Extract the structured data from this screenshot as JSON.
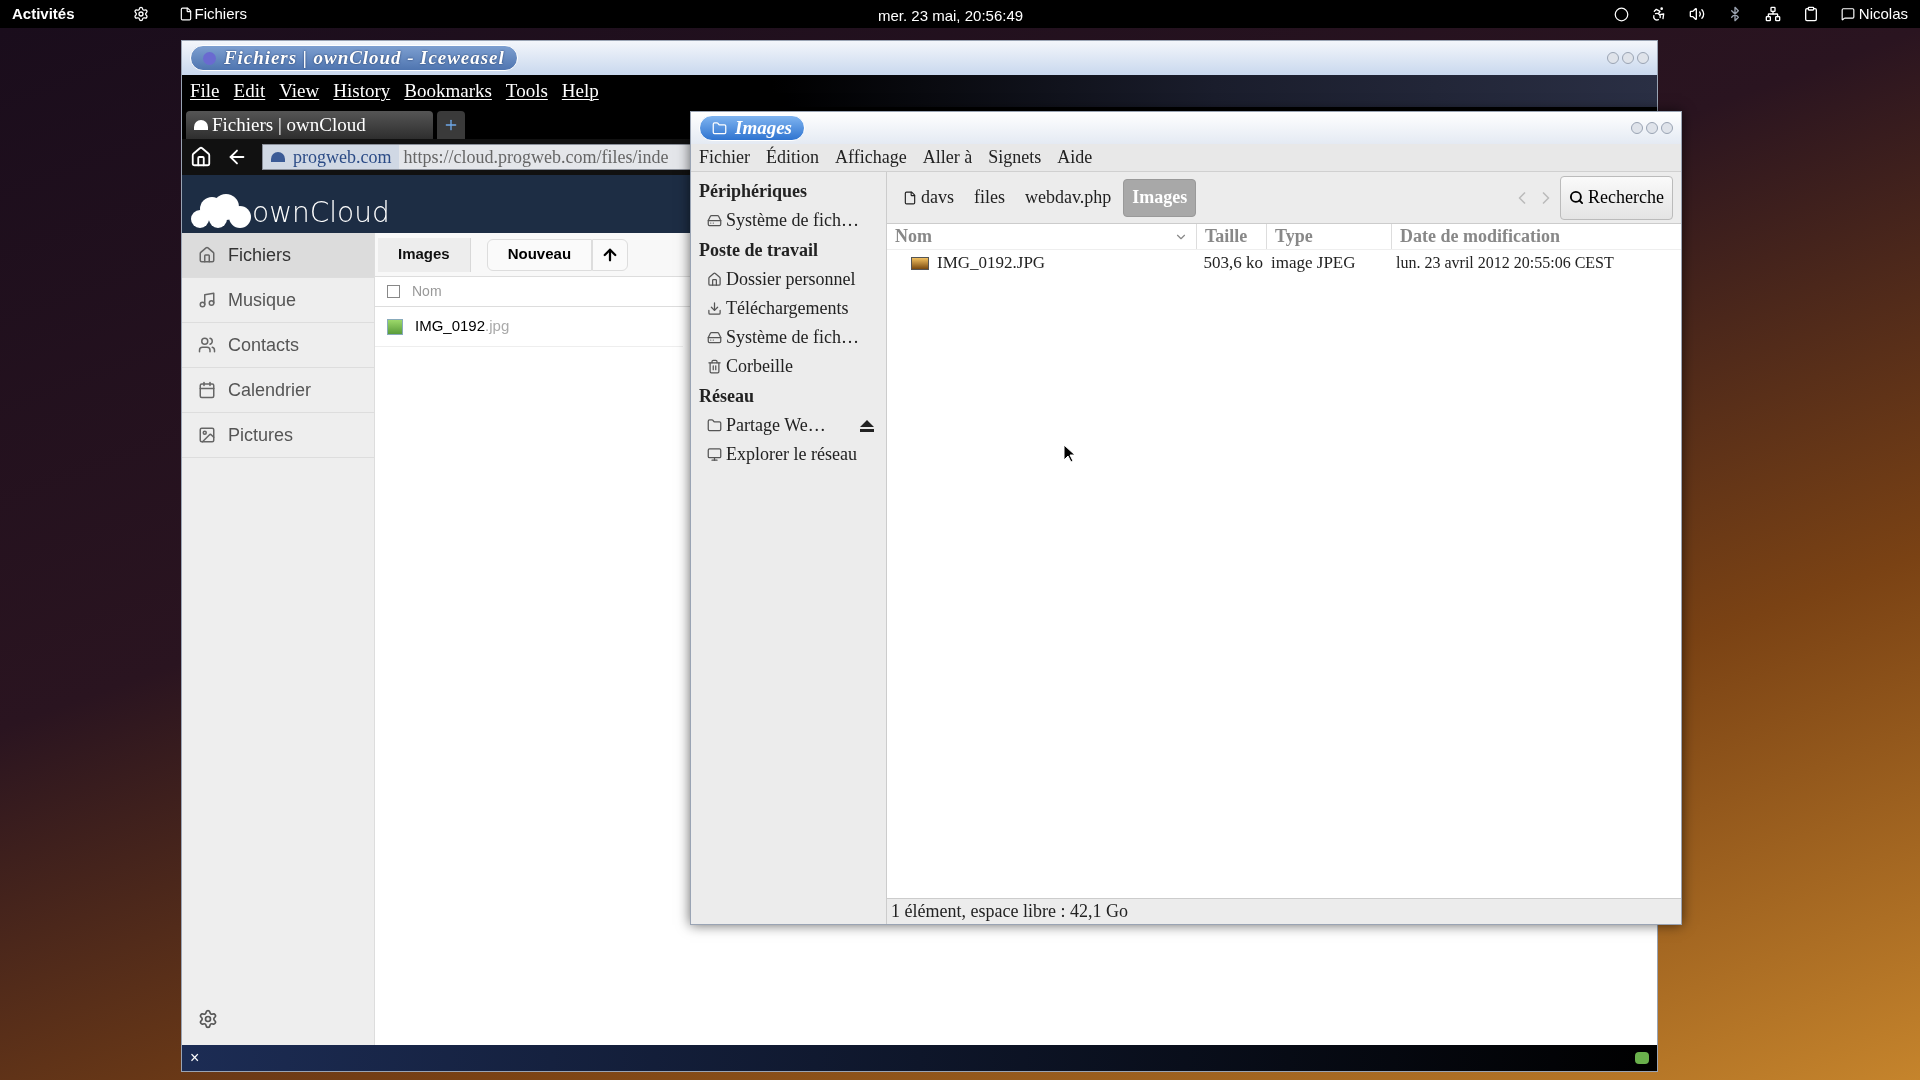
{
  "top_bar": {
    "activities": "Activités",
    "app_name": "Fichiers",
    "clock": "mer. 23 mai, 20:56:49",
    "user": "Nicolas"
  },
  "browser": {
    "title": "Fichiers | ownCloud - Iceweasel",
    "menu": [
      "File",
      "Edit",
      "View",
      "History",
      "Bookmarks",
      "Tools",
      "Help"
    ],
    "tab": "Fichiers | ownCloud",
    "address": {
      "domain": "progweb.com",
      "url": "https://cloud.progweb.com/files/inde"
    },
    "owncloud": {
      "logo": "ownCloud",
      "sidebar": [
        {
          "kind": "home",
          "label": "Fichiers",
          "selected": true
        },
        {
          "kind": "music",
          "label": "Musique",
          "selected": false
        },
        {
          "kind": "contacts",
          "label": "Contacts",
          "selected": false
        },
        {
          "kind": "calendar",
          "label": "Calendrier",
          "selected": false
        },
        {
          "kind": "pictures",
          "label": "Pictures",
          "selected": false
        }
      ],
      "select_all": {
        "checked": false
      },
      "breadcrumb": "Images",
      "new_button": "Nouveau",
      "column": "Nom",
      "files": [
        {
          "name": "IMG_0192",
          "ext": ".jpg"
        }
      ]
    },
    "bottom_bar": {
      "close": "×"
    }
  },
  "file_manager": {
    "title": "Images",
    "menu": [
      "Fichier",
      "Édition",
      "Affichage",
      "Aller à",
      "Signets",
      "Aide"
    ],
    "sidebar": [
      {
        "heading": "Périphériques",
        "items": [
          {
            "kind": "drive",
            "label": "Système de fich…",
            "eject": false
          }
        ]
      },
      {
        "heading": "Poste de travail",
        "items": [
          {
            "kind": "home",
            "label": "Dossier personnel",
            "eject": false
          },
          {
            "kind": "folder",
            "label": "Téléchargements",
            "eject": false
          },
          {
            "kind": "drive",
            "label": "Système de fich…",
            "eject": false
          },
          {
            "kind": "trash",
            "label": "Corbeille",
            "eject": false
          }
        ]
      },
      {
        "heading": "Réseau",
        "items": [
          {
            "kind": "share",
            "label": "Partage We…",
            "eject": true
          },
          {
            "kind": "network",
            "label": "Explorer le réseau",
            "eject": false
          }
        ]
      }
    ],
    "path": [
      {
        "label": "davs",
        "selected": false
      },
      {
        "label": "files",
        "selected": false
      },
      {
        "label": "webdav.php",
        "selected": false
      },
      {
        "label": "Images",
        "selected": true
      }
    ],
    "search": "Recherche",
    "columns": [
      "Nom",
      "Taille",
      "Type",
      "Date de modification"
    ],
    "rows": [
      {
        "name": "IMG_0192.JPG",
        "size": "503,6 ko",
        "type": "image JPEG",
        "date": "lun. 23 avril 2012 20:55:06 CEST"
      }
    ],
    "status": "1 élément, espace libre : 42,1 Go"
  }
}
